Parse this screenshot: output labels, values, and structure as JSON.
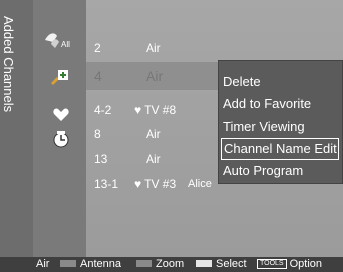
{
  "panel_title": "Added Channels",
  "filters": [
    {
      "name": "all-icon",
      "label": "All"
    },
    {
      "name": "added-channels-icon"
    },
    {
      "name": "favorite-icon"
    },
    {
      "name": "programmed-icon"
    }
  ],
  "channels": [
    {
      "number": "2",
      "name": "Air",
      "favorite": false,
      "selected": false,
      "extra": ""
    },
    {
      "number": "4",
      "name": "Air",
      "favorite": false,
      "selected": true,
      "extra": ""
    },
    {
      "number": "4-2",
      "name": "TV #8",
      "favorite": true,
      "selected": false,
      "extra": ""
    },
    {
      "number": "8",
      "name": "Air",
      "favorite": false,
      "selected": false,
      "extra": ""
    },
    {
      "number": "13",
      "name": "Air",
      "favorite": false,
      "selected": false,
      "extra": ""
    },
    {
      "number": "13-1",
      "name": "TV #3",
      "favorite": true,
      "selected": false,
      "extra": "Alice"
    }
  ],
  "favorite_symbol": "♥",
  "context_menu": {
    "items": [
      "Delete",
      "Add to Favorite",
      "Timer Viewing",
      "Channel Name Edit",
      "Auto Program"
    ],
    "focused_index": 3
  },
  "bottom_bar": {
    "source": "Air",
    "antenna_label": "Antenna",
    "zoom_label": "Zoom",
    "select_label": "Select",
    "tools_key": "TOOLS",
    "option_label": "Option"
  },
  "colors": {
    "red_key": "#b23b3b",
    "green_key": "#3ea03e",
    "yellow_key": "#d2c63b",
    "blue_key": "#3e63b8"
  }
}
